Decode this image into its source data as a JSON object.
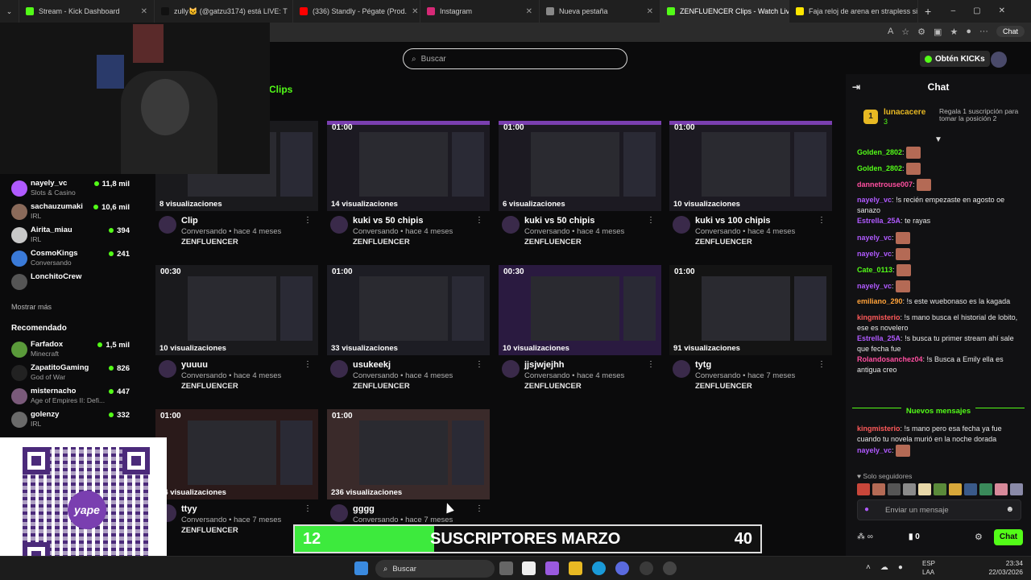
{
  "browser": {
    "tabs": [
      {
        "title": "Stream - Kick Dashboard",
        "color": "#53fc18"
      },
      {
        "title": "zully🐱 (@gatzu3174) está LIVE: T",
        "color": "#111111"
      },
      {
        "title": "(336) Standly - Pégate (Prod.",
        "color": "#ff0000"
      },
      {
        "title": "Instagram",
        "color": "#d62976"
      },
      {
        "title": "Nueva pestaña",
        "color": "#888888"
      },
      {
        "title": "ZENFLUENCER Clips - Watch Live",
        "color": "#53fc18"
      },
      {
        "title": "Faja reloj de arena en strapless sin",
        "color": "#ffe600"
      }
    ],
    "chat_button": "Chat"
  },
  "header": {
    "search_placeholder": "Buscar",
    "get_kicks": "Obtén KICKs",
    "section": "Clips"
  },
  "sidebar": {
    "channels": [
      {
        "name": "nayely_vc",
        "category": "Slots & Casino",
        "viewers": "11,8 mil",
        "color": "#b05aff"
      },
      {
        "name": "sachauzumaki",
        "category": "IRL",
        "viewers": "10,6 mil",
        "color": "#8a6a5a"
      },
      {
        "name": "Airita_miau",
        "category": "IRL",
        "viewers": "394",
        "color": "#c8c8c8"
      },
      {
        "name": "CosmoKings",
        "category": "Conversando",
        "viewers": "241",
        "color": "#3a7ad8"
      },
      {
        "name": "LonchitoCrew",
        "category": "",
        "viewers": "",
        "color": "#555555"
      }
    ],
    "show_more": "Mostrar más",
    "recommended_title": "Recomendado",
    "recommended": [
      {
        "name": "Farfadox",
        "category": "Minecraft",
        "viewers": "1,5 mil",
        "color": "#5a9a3a"
      },
      {
        "name": "ZapatitoGaming",
        "category": "God of War",
        "viewers": "826",
        "color": "#222222"
      },
      {
        "name": "misternacho",
        "category": "Age of Empires II: Defi...",
        "viewers": "447",
        "color": "#7a5a7a"
      },
      {
        "name": "golenzy",
        "category": "IRL",
        "viewers": "332",
        "color": "#6a6a6a"
      }
    ]
  },
  "qr": {
    "logo_text": "yape"
  },
  "clips": [
    {
      "duration": "",
      "views": "8 visualizaciones",
      "title": "Clip",
      "subtitle": "Conversando • hace 4 meses",
      "channel": "ZENFLUENCER"
    },
    {
      "duration": "01:00",
      "views": "14 visualizaciones",
      "title": "kuki vs 50 chipis",
      "subtitle": "Conversando • hace 4 meses",
      "channel": "ZENFLUENCER"
    },
    {
      "duration": "01:00",
      "views": "6 visualizaciones",
      "title": "kuki vs 50 chipis",
      "subtitle": "Conversando • hace 4 meses",
      "channel": "ZENFLUENCER"
    },
    {
      "duration": "01:00",
      "views": "10 visualizaciones",
      "title": "kuki vs 100 chipis",
      "subtitle": "Conversando • hace 4 meses",
      "channel": "ZENFLUENCER"
    },
    {
      "duration": "00:30",
      "views": "10 visualizaciones",
      "title": "yuuuu",
      "subtitle": "Conversando • hace 4 meses",
      "channel": "ZENFLUENCER"
    },
    {
      "duration": "01:00",
      "views": "33 visualizaciones",
      "title": "usukeekj",
      "subtitle": "Conversando • hace 4 meses",
      "channel": "ZENFLUENCER"
    },
    {
      "duration": "00:30",
      "views": "10 visualizaciones",
      "title": "jjsjwjejhh",
      "subtitle": "Conversando • hace 4 meses",
      "channel": "ZENFLUENCER"
    },
    {
      "duration": "01:00",
      "views": "91 visualizaciones",
      "title": "tytg",
      "subtitle": "Conversando • hace 7 meses",
      "channel": "ZENFLUENCER"
    },
    {
      "duration": "01:00",
      "views": "54 visualizaciones",
      "title": "ttyy",
      "subtitle": "Conversando • hace 7 meses",
      "channel": "ZENFLUENCER"
    },
    {
      "duration": "01:00",
      "views": "236 visualizaciones",
      "title": "gggg",
      "subtitle": "Conversando • hace 7 meses",
      "channel": ""
    }
  ],
  "sub_goal": {
    "current": "12",
    "label": "SUSCRIPTORES MARZO",
    "goal": "40",
    "progress": 0.3
  },
  "chat": {
    "title": "Chat",
    "pinned": {
      "rank": "1",
      "user": "lunacacere",
      "count": "3",
      "gift_text": "Regala 1 suscripción para tomar la posición 2"
    },
    "messages": [
      {
        "user": "Golden_2802",
        "color": "#53fc18",
        "text": "",
        "emote": true
      },
      {
        "user": "Golden_2802",
        "color": "#53fc18",
        "text": "",
        "emote": true
      },
      {
        "user": "dannetrouse007",
        "color": "#ff4fa0",
        "text": "",
        "emote": true
      },
      {
        "user": "nayely_vc",
        "color": "#b05aff",
        "text": "!s recién empezaste en agosto oe sanazo",
        "emote": false
      },
      {
        "user": "Estrella_25A",
        "color": "#b05aff",
        "text": "te rayas",
        "emote": false
      },
      {
        "user": "nayely_vc",
        "color": "#b05aff",
        "text": "",
        "emote": true
      },
      {
        "user": "nayely_vc",
        "color": "#b05aff",
        "text": "",
        "emote": true
      },
      {
        "user": "Cate_0113",
        "color": "#53fc18",
        "text": "",
        "emote": true
      },
      {
        "user": "nayely_vc",
        "color": "#b05aff",
        "text": "",
        "emote": true
      },
      {
        "user": "emiliano_290",
        "color": "#ffa23a",
        "text": "!s este wuebonaso es la kagada",
        "emote": false
      },
      {
        "user": "kingmisterio",
        "color": "#ff5a5a",
        "text": "!s mano busca el historial de lobito, ese es novelero",
        "emote": false
      },
      {
        "user": "Estrella_25A",
        "color": "#b05aff",
        "text": "!s busca tu primer stream ahí sale que fecha fue",
        "emote": false
      },
      {
        "user": "Rolandosanchez04",
        "color": "#ff4fa0",
        "text": "!s Busca a Emily ella es antigua creo",
        "emote": false
      }
    ],
    "new_messages_label": "Nuevos mensajes",
    "new_messages": [
      {
        "user": "kingmisterio",
        "color": "#ff5a5a",
        "text": "!s mano pero esa fecha ya fue cuando tu novela murió en la noche dorada",
        "emote": false
      },
      {
        "user": "nayely_vc",
        "color": "#b05aff",
        "text": "",
        "emote": true
      }
    ],
    "followers_only": "Solo seguidores",
    "input_placeholder": "Enviar un mensaje",
    "points": "0",
    "send_label": "Chat"
  },
  "taskbar": {
    "search": "Buscar",
    "lang_1": "ESP",
    "lang_2": "LAA",
    "time": "23:34",
    "date": "22/03/2026"
  }
}
